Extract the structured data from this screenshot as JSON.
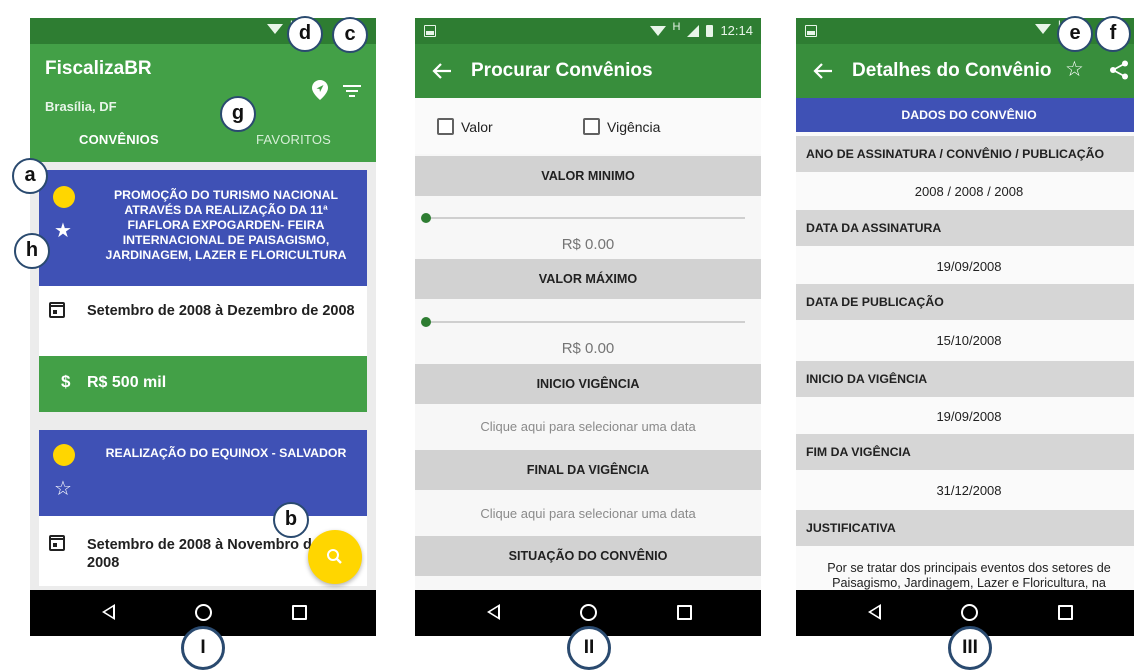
{
  "phone1": {
    "app_title": "FiscalizaBR",
    "city": "Brasília, DF",
    "tabs": {
      "convenios": "CONVÊNIOS",
      "favoritos": "FAVORITOS"
    },
    "cards": [
      {
        "title": "PROMOÇÃO DO TURISMO NACIONAL ATRAVÉS DA REALIZAÇÃO DA 11ª FIAFLORA EXPOGARDEN- FEIRA INTERNACIONAL DE PAISAGISMO, JARDINAGEM, LAZER E FLORICULTURA",
        "date": "Setembro de 2008 à Dezembro de 2008",
        "value": "R$ 500 mil",
        "dollar_symbol": "$",
        "favorite": true
      },
      {
        "title": "REALIZAÇÃO DO EQUINOX - SALVADOR",
        "date": "Setembro de 2008 à Novembro de 2008",
        "favorite": false
      }
    ],
    "star_filled": "★",
    "star_outline": "☆"
  },
  "phone2": {
    "app_title": "Procurar Convênios",
    "time": "12:14",
    "checkboxes": {
      "valor": "Valor",
      "vigencia": "Vigência"
    },
    "sections": {
      "valor_minimo": "VALOR MINIMO",
      "valor_maximo": "VALOR MÁXIMO",
      "inicio_vigencia": "INICIO VIGÊNCIA",
      "final_vigencia": "FINAL DA VIGÊNCIA",
      "situacao": "SITUAÇÃO DO CONVÊNIO"
    },
    "valor_minimo_display": "R$ 0.00",
    "valor_maximo_display": "R$ 0.00",
    "slider_min_level": 0,
    "slider_max_level": 0,
    "date_hint_inicio": "Clique aqui para selecionar uma data",
    "date_hint_final": "Clique aqui para selecionar uma data"
  },
  "phone3": {
    "app_title": "Detalhes do Convênio",
    "star_outline": "☆",
    "section_header": "DADOS DO CONVÊNIO",
    "fields": [
      {
        "label": "ANO DE ASSINATURA / CONVÊNIO / PUBLICAÇÃO",
        "value": "2008 / 2008 / 2008"
      },
      {
        "label": "DATA DA ASSINATURA",
        "value": "19/09/2008"
      },
      {
        "label": "DATA DE PUBLICAÇÃO",
        "value": "15/10/2008"
      },
      {
        "label": "INICIO DA VIGÊNCIA",
        "value": "19/09/2008"
      },
      {
        "label": "FIM DA VIGÊNCIA",
        "value": "31/12/2008"
      },
      {
        "label": "JUSTIFICATIVA",
        "value": "Por se tratar dos principais eventos dos setores de Paisagismo, Jardinagem, Lazer e Floricultura,  na"
      }
    ]
  },
  "status_h": "H",
  "callouts": {
    "a": "a",
    "b": "b",
    "c": "c",
    "d": "d",
    "e": "e",
    "f": "f",
    "g": "g",
    "h": "h"
  },
  "screen_labels": {
    "one": "I",
    "two": "II",
    "three": "III"
  },
  "colors": {
    "primary_green": "#43a047",
    "dark_green": "#2e7d32",
    "indigo": "#3f51b5",
    "accent_yellow": "#ffd600",
    "section_gray": "#d2d2d2"
  },
  "icons": [
    "wifi-icon",
    "signal-icon",
    "battery-icon",
    "location-pin-icon",
    "filter-icon",
    "star-icon",
    "calendar-icon",
    "dollar-icon",
    "search-icon",
    "back-arrow-icon",
    "share-icon",
    "nav-back-icon",
    "nav-home-icon",
    "nav-recents-icon",
    "checkbox-icon"
  ]
}
